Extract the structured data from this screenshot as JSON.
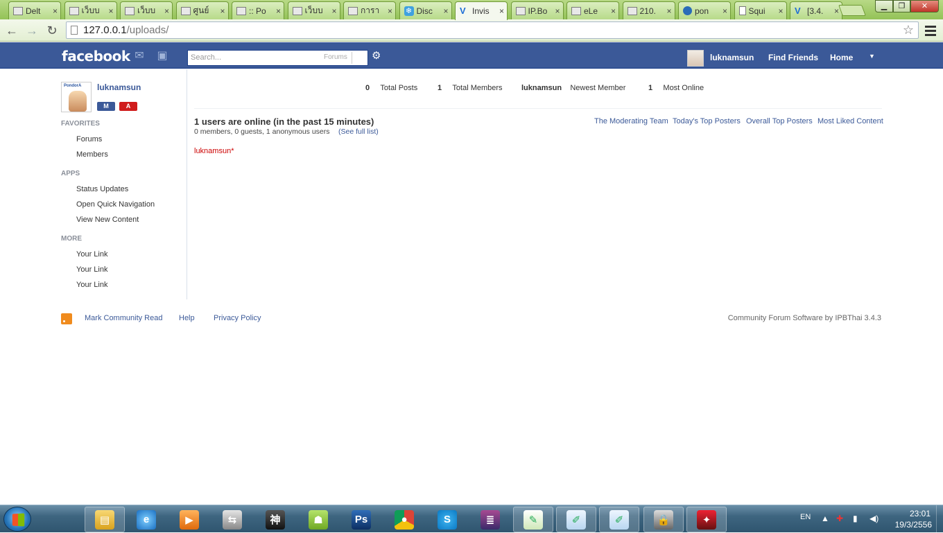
{
  "browser": {
    "tabs": [
      {
        "label": "Delt",
        "icon": "folder-icon"
      },
      {
        "label": "เว็บบ",
        "icon": "folder-icon"
      },
      {
        "label": "เว็บบ",
        "icon": "folder-icon"
      },
      {
        "label": "ศูนย์",
        "icon": "folder-icon"
      },
      {
        "label": ":: Po",
        "icon": "folder-icon"
      },
      {
        "label": "เว็บบ",
        "icon": "folder-icon"
      },
      {
        "label": "การา",
        "icon": "folder-icon"
      },
      {
        "label": "Disc",
        "icon": "snowflake-icon"
      },
      {
        "label": "Invis",
        "icon": "ipb-icon",
        "active": true
      },
      {
        "label": "IP.Bo",
        "icon": "folder-icon"
      },
      {
        "label": "eLe",
        "icon": "folder-icon"
      },
      {
        "label": "210.",
        "icon": "folder-icon"
      },
      {
        "label": "pon",
        "icon": "circle-icon"
      },
      {
        "label": "Squi",
        "icon": "page-icon"
      },
      {
        "label": "[3.4.",
        "icon": "ipb-icon"
      }
    ],
    "tab_close_glyph": "×",
    "url": {
      "host": "127.0.0.1",
      "path": "/uploads/"
    }
  },
  "header": {
    "logo": "facebook",
    "search_placeholder": "Search...",
    "search_scope": "Forums",
    "username": "luknamsun",
    "find_friends": "Find Friends",
    "home": "Home"
  },
  "sidebar": {
    "username": "luknamsun",
    "avatar_text": "PondorA",
    "badge_m": "M",
    "badge_a": "A",
    "favorites_heading": "FAVORITES",
    "favorites": [
      "Forums",
      "Members"
    ],
    "apps_heading": "APPS",
    "apps": [
      "Status Updates",
      "Open Quick Navigation",
      "View New Content"
    ],
    "more_heading": "MORE",
    "more": [
      "Your Link",
      "Your Link",
      "Your Link"
    ]
  },
  "stats": [
    {
      "value": "0",
      "label": "Total Posts"
    },
    {
      "value": "1",
      "label": "Total Members"
    },
    {
      "value": "luknamsun",
      "label": "Newest Member"
    },
    {
      "value": "1",
      "label": "Most Online"
    }
  ],
  "online": {
    "title": "1 users are online (in the past 15 minutes)",
    "subtitle": "0 members, 0 guests, 1 anonymous users",
    "full_list": "(See full list)",
    "users": "luknamsun*"
  },
  "right_links": [
    "The Moderating Team",
    "Today's Top Posters",
    "Overall Top Posters",
    "Most Liked Content"
  ],
  "footer": {
    "mark_read": "Mark Community Read",
    "help": "Help",
    "privacy": "Privacy Policy",
    "powered": "Community Forum Software by IPBThai 3.4.3"
  },
  "taskbar": {
    "apps": [
      "explorer",
      "ie",
      "media",
      "network",
      "game",
      "android",
      "photoshop",
      "chrome",
      "skype",
      "winrar",
      "notepad-plus",
      "editor",
      "editor",
      "lock",
      "game2",
      "photoshop"
    ],
    "language": "EN",
    "time": "23:01",
    "date": "19/3/2556"
  },
  "colors": {
    "brand": "#3b5998",
    "tabstrip": "#93c257",
    "online_user": "#cc0000"
  }
}
